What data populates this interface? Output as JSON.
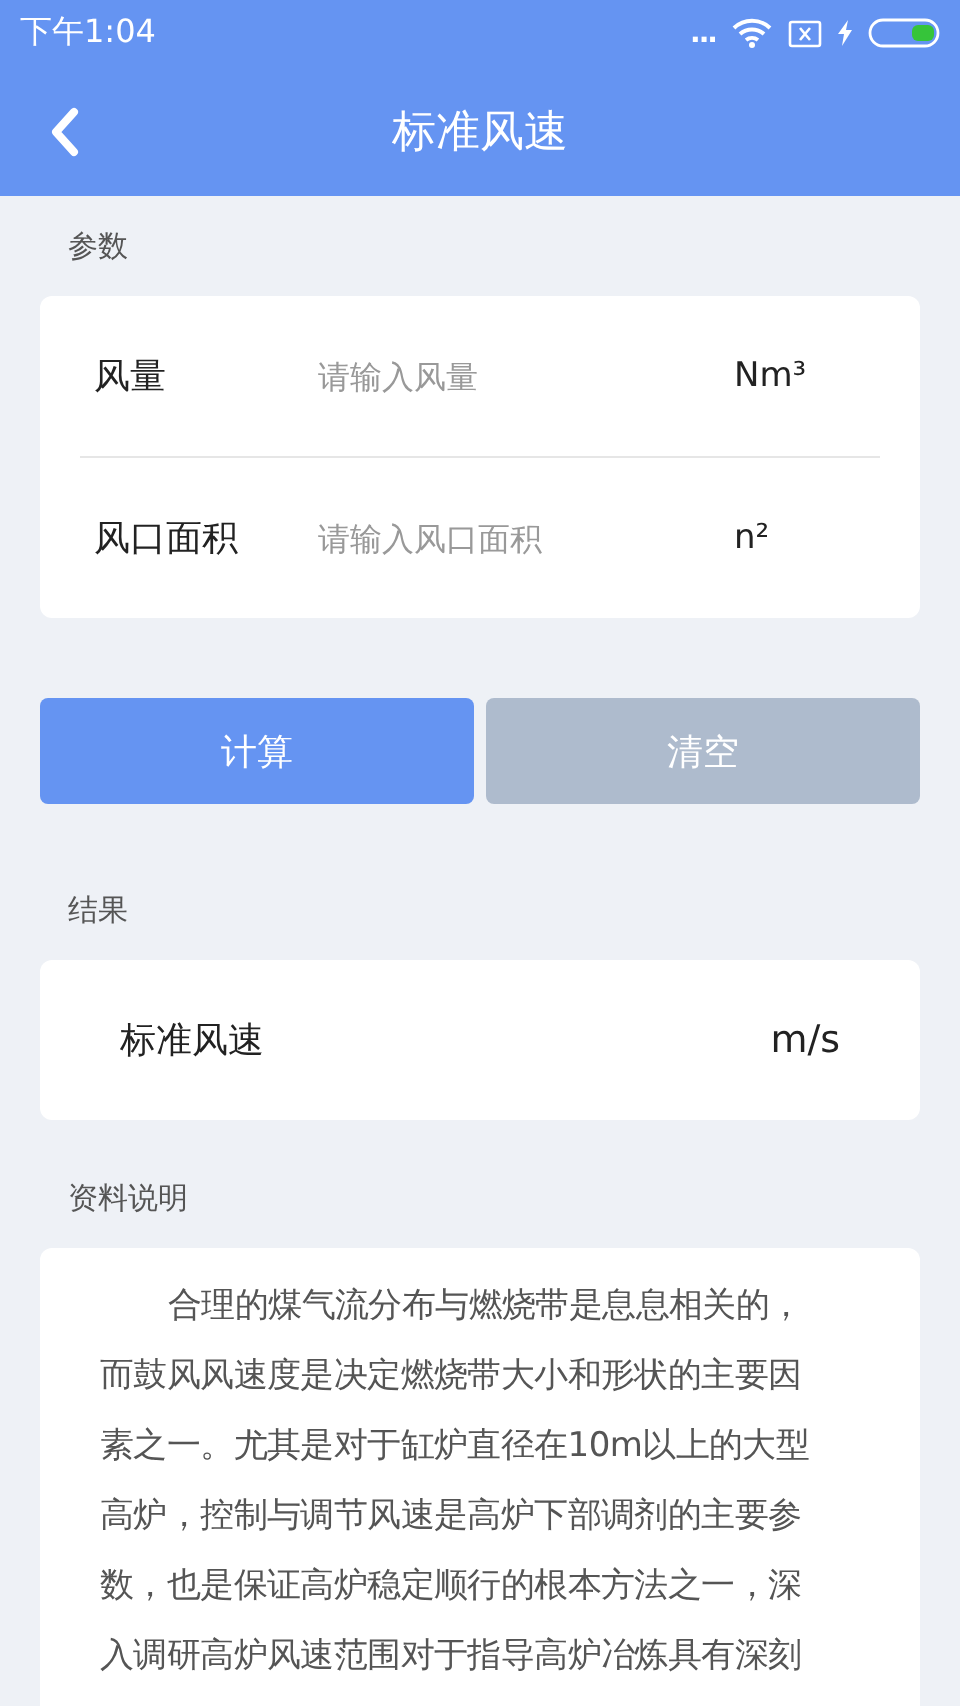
{
  "status_bar": {
    "time": "下午1:04",
    "dots": "..."
  },
  "header": {
    "title": "标准风速"
  },
  "params": {
    "label": "参数",
    "rows": [
      {
        "label": "风量",
        "placeholder": "请输入风量",
        "unit": "Nm³"
      },
      {
        "label": "风口面积",
        "placeholder": "请输入风口面积",
        "unit": "n²"
      }
    ]
  },
  "buttons": [
    {
      "label": "计算",
      "kind": "primary"
    },
    {
      "label": "清空",
      "kind": "secondary"
    }
  ],
  "result": {
    "label": "结果",
    "name": "标准风速",
    "unit": "m/s"
  },
  "description": {
    "label": "资料说明",
    "lines": [
      "合理的煤气流分布与燃烧带是息息相关的，",
      "而鼓风风速度是决定燃烧带大小和形状的主要因",
      "素之一。尤其是对于缸炉直径在10m以上的大型",
      "高炉，控制与调节风速是高炉下部调剂的主要参",
      "数，也是保证高炉稳定顺行的根本方法之一，深",
      "入调研高炉风速范围对于指导高炉冶炼具有深刻"
    ]
  }
}
